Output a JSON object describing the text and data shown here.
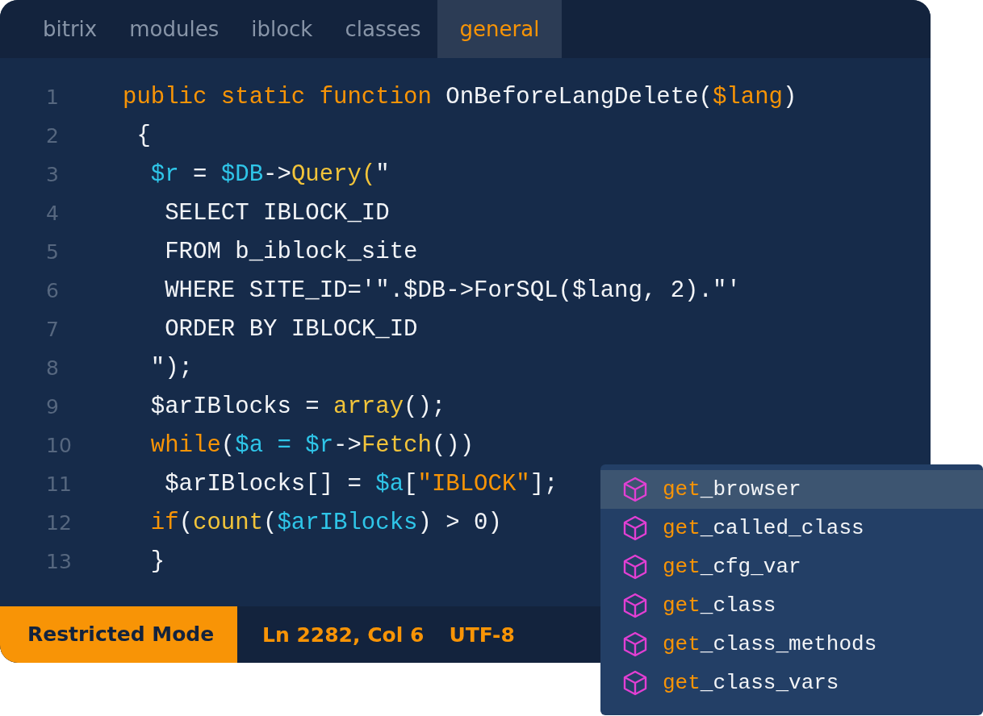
{
  "tabs": [
    {
      "label": "bitrix",
      "selected": false
    },
    {
      "label": "modules",
      "selected": false
    },
    {
      "label": "iblock",
      "selected": false
    },
    {
      "label": "classes",
      "selected": false
    },
    {
      "label": "general",
      "selected": true
    }
  ],
  "code": {
    "lines": [
      {
        "number": "1",
        "segments": [
          {
            "text": "public static function",
            "kind": "keyword"
          },
          {
            "text": " OnBeforeLangDelete(",
            "kind": "plain"
          },
          {
            "text": "$lang",
            "kind": "keyword"
          },
          {
            "text": ")",
            "kind": "plain"
          }
        ]
      },
      {
        "number": "2",
        "segments": [
          {
            "text": " {",
            "kind": "plain"
          }
        ]
      },
      {
        "number": "3",
        "segments": [
          {
            "text": "  $r",
            "kind": "variable"
          },
          {
            "text": " = ",
            "kind": "plain"
          },
          {
            "text": "$DB",
            "kind": "variable"
          },
          {
            "text": "->",
            "kind": "plain"
          },
          {
            "text": "Query(",
            "kind": "function"
          },
          {
            "text": "\"",
            "kind": "plain"
          }
        ]
      },
      {
        "number": "4",
        "segments": [
          {
            "text": "   SELECT IBLOCK_ID",
            "kind": "plain"
          }
        ]
      },
      {
        "number": "5",
        "segments": [
          {
            "text": "   FROM b_iblock_site",
            "kind": "plain"
          }
        ]
      },
      {
        "number": "6",
        "segments": [
          {
            "text": "   WHERE SITE_ID='\".$DB->ForSQL($lang, 2).\"'",
            "kind": "plain"
          }
        ]
      },
      {
        "number": "7",
        "segments": [
          {
            "text": "   ORDER BY IBLOCK_ID",
            "kind": "plain"
          }
        ]
      },
      {
        "number": "8",
        "segments": [
          {
            "text": "  \");",
            "kind": "plain"
          }
        ]
      },
      {
        "number": "9",
        "segments": [
          {
            "text": "  $arIBlocks = ",
            "kind": "plain"
          },
          {
            "text": "array",
            "kind": "function"
          },
          {
            "text": "();",
            "kind": "plain"
          }
        ]
      },
      {
        "number": "10",
        "segments": [
          {
            "text": "  while",
            "kind": "keyword"
          },
          {
            "text": "(",
            "kind": "plain"
          },
          {
            "text": "$a = $r",
            "kind": "variable"
          },
          {
            "text": "->",
            "kind": "plain"
          },
          {
            "text": "Fetch",
            "kind": "function"
          },
          {
            "text": "())",
            "kind": "plain"
          }
        ]
      },
      {
        "number": "11",
        "segments": [
          {
            "text": "   $arIBlocks[] = ",
            "kind": "plain"
          },
          {
            "text": "$a",
            "kind": "variable"
          },
          {
            "text": "[",
            "kind": "plain"
          },
          {
            "text": "\"IBLOCK\"",
            "kind": "keyword"
          },
          {
            "text": "];",
            "kind": "plain"
          }
        ]
      },
      {
        "number": "12",
        "segments": [
          {
            "text": "  if",
            "kind": "keyword"
          },
          {
            "text": "(",
            "kind": "plain"
          },
          {
            "text": "count",
            "kind": "function"
          },
          {
            "text": "(",
            "kind": "plain"
          },
          {
            "text": "$arIBlocks",
            "kind": "variable"
          },
          {
            "text": ") > 0)",
            "kind": "plain"
          }
        ]
      },
      {
        "number": "13",
        "segments": [
          {
            "text": "  }",
            "kind": "plain"
          }
        ]
      }
    ]
  },
  "status_bar": {
    "mode": "Restricted Mode",
    "position": "Ln 2282, Col 6",
    "encoding": "UTF-8"
  },
  "suggestions": [
    {
      "match": "get",
      "rest": "_browser",
      "selected": true
    },
    {
      "match": "get",
      "rest": "_called_class",
      "selected": false
    },
    {
      "match": "get",
      "rest": "_cfg_var",
      "selected": false
    },
    {
      "match": "get",
      "rest": "_class",
      "selected": false
    },
    {
      "match": "get",
      "rest": "_class_methods",
      "selected": false
    },
    {
      "match": "get",
      "rest": "_class_vars",
      "selected": false
    }
  ]
}
